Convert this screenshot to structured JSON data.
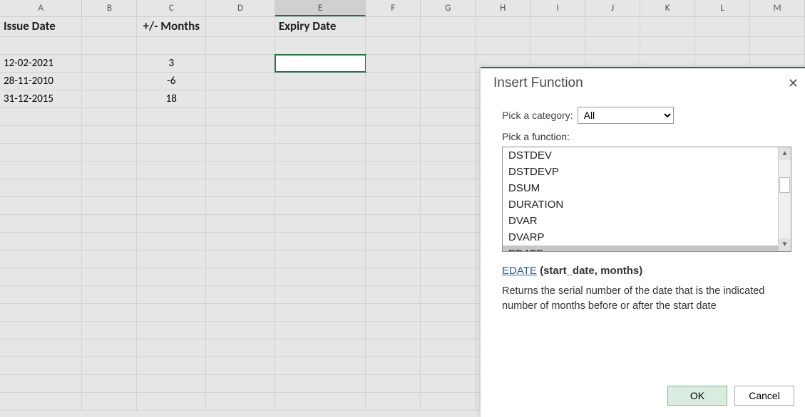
{
  "columns": [
    "A",
    "B",
    "C",
    "D",
    "E",
    "F",
    "G",
    "H",
    "I",
    "J",
    "K",
    "L",
    "M"
  ],
  "selected_column": "E",
  "sheet": {
    "row2": {
      "A": "Issue Date",
      "C": "+/- Months",
      "E": "Expiry Date"
    },
    "row4": {
      "A": "12-02-2021",
      "C": "3"
    },
    "row5": {
      "A": "28-11-2010",
      "C": "-6"
    },
    "row6": {
      "A": "31-12-2015",
      "C": "18"
    }
  },
  "dialog": {
    "title": "Insert Function",
    "close_glyph": "✕",
    "category_label": "Pick a category:",
    "category_value": "All",
    "function_label": "Pick a function:",
    "functions": [
      "DSTDEV",
      "DSTDEVP",
      "DSUM",
      "DURATION",
      "DVAR",
      "DVARP",
      "EDATE"
    ],
    "selected_function": "EDATE",
    "signature_name": "EDATE",
    "signature_args": "(start_date, months)",
    "description": "Returns the serial number of the date that is the indicated number of months before or after the start date",
    "ok_label": "OK",
    "cancel_label": "Cancel",
    "scroll_up": "▲",
    "scroll_down": "▼"
  }
}
